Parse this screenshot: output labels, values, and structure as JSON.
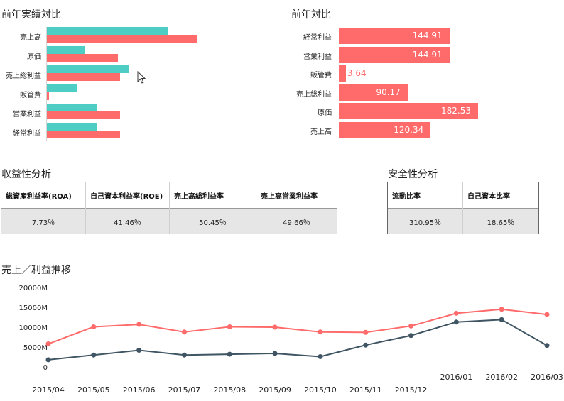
{
  "yoy_panel": {
    "title": "前年実績対比",
    "items": [
      {
        "label": "売上高",
        "current": 0.63,
        "previous": 0.78
      },
      {
        "label": "原価",
        "current": 0.2,
        "previous": 0.37
      },
      {
        "label": "売上総利益",
        "current": 0.43,
        "previous": 0.38
      },
      {
        "label": "販管費",
        "current": 0.16,
        "previous": 0.01
      },
      {
        "label": "営業利益",
        "current": 0.26,
        "previous": 0.38
      },
      {
        "label": "経常利益",
        "current": 0.26,
        "previous": 0.38
      }
    ]
  },
  "yoy_ratio_panel": {
    "title": "前年対比",
    "items": [
      {
        "label": "経常利益",
        "value": 144.91,
        "display": "144.91"
      },
      {
        "label": "営業利益",
        "value": 144.91,
        "display": "144.91"
      },
      {
        "label": "販管費",
        "value": 3.64,
        "display": "3.64"
      },
      {
        "label": "売上総利益",
        "value": 90.17,
        "display": "90.17"
      },
      {
        "label": "原価",
        "value": 182.53,
        "display": "182.53"
      },
      {
        "label": "売上高",
        "value": 120.34,
        "display": "120.34"
      }
    ]
  },
  "profitability": {
    "title": "収益性分析",
    "headers": [
      "総資産利益率(ROA)",
      "自己資本利益率(ROE)",
      "売上高総利益率",
      "売上高営業利益率"
    ],
    "values": [
      "7.73％",
      "41.46％",
      "50.45％",
      "49.66％"
    ]
  },
  "safety": {
    "title": "安全性分析",
    "headers": [
      "流動比率",
      "自己資本比率"
    ],
    "values": [
      "310.95％",
      "18.65％"
    ]
  },
  "trend": {
    "title": "売上／利益推移",
    "chart_data": {
      "type": "line",
      "x": [
        "2015/04",
        "2015/05",
        "2015/06",
        "2015/07",
        "2015/08",
        "2015/09",
        "2015/10",
        "2015/11",
        "2015/12",
        "2016/01",
        "2016/02",
        "2016/03"
      ],
      "yticks": [
        "0",
        "5000M",
        "10000M",
        "15000M",
        "20000M"
      ],
      "ylim": [
        0,
        20000
      ],
      "series": [
        {
          "color": "#ff6b6b",
          "values": [
            5800,
            10100,
            10700,
            8800,
            10100,
            10000,
            8800,
            8700,
            10300,
            13500,
            14500,
            13200
          ]
        },
        {
          "color": "#3f5563",
          "values": [
            1800,
            3000,
            4200,
            3000,
            3200,
            3400,
            2600,
            5500,
            7900,
            11300,
            11900,
            5400
          ]
        }
      ]
    }
  },
  "colors": {
    "teal": "#4ecdc4",
    "red": "#ff6b6b",
    "slate": "#3f5563"
  }
}
